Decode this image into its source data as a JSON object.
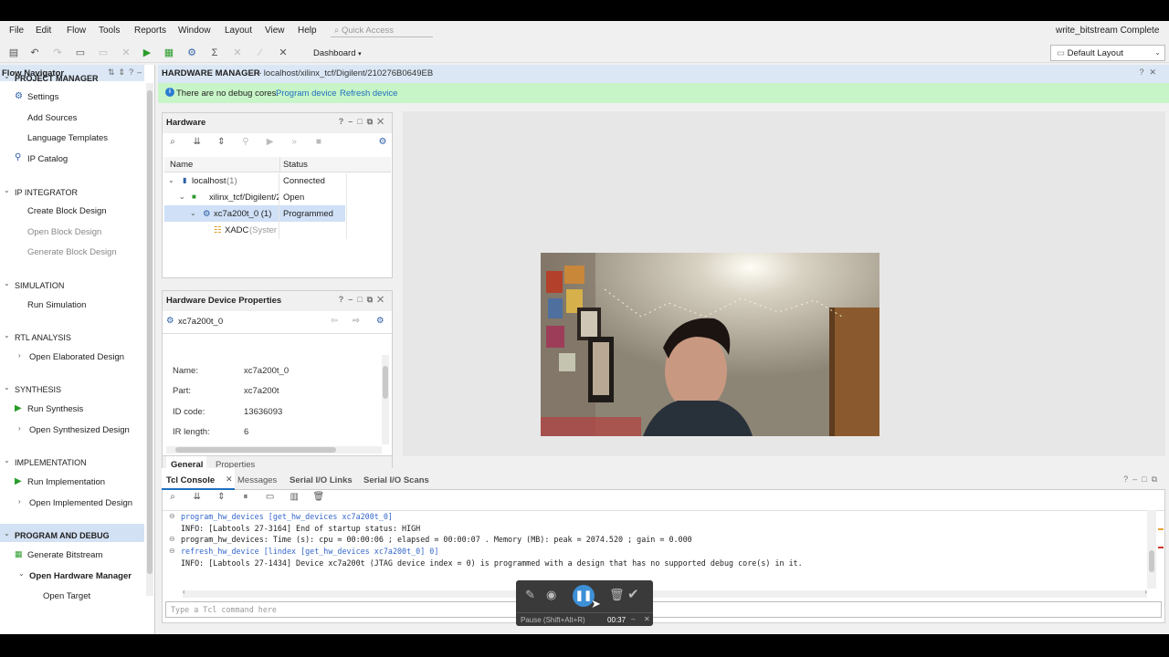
{
  "menu": [
    "File",
    "Edit",
    "Flow",
    "Tools",
    "Reports",
    "Window",
    "Layout",
    "View",
    "Help"
  ],
  "quick_access_placeholder": "Quick Access",
  "status_top": "write_bitstream Complete",
  "dashboard_label": "Dashboard",
  "layout_select": "Default Layout",
  "flow_nav": {
    "title": "Flow Navigator",
    "project_manager": "PROJECT MANAGER",
    "settings": "Settings",
    "add_sources": "Add Sources",
    "language_templates": "Language Templates",
    "ip_catalog": "IP Catalog",
    "ip_integrator": "IP INTEGRATOR",
    "create_block": "Create Block Design",
    "open_block": "Open Block Design",
    "generate_block": "Generate Block Design",
    "simulation": "SIMULATION",
    "run_simulation": "Run Simulation",
    "rtl_analysis": "RTL ANALYSIS",
    "open_elaborated": "Open Elaborated Design",
    "synthesis": "SYNTHESIS",
    "run_synthesis": "Run Synthesis",
    "open_synthesized": "Open Synthesized Design",
    "implementation": "IMPLEMENTATION",
    "run_implementation": "Run Implementation",
    "open_implemented": "Open Implemented Design",
    "program_debug": "PROGRAM AND DEBUG",
    "generate_bitstream": "Generate Bitstream",
    "open_hw_manager": "Open Hardware Manager",
    "open_target": "Open Target"
  },
  "hw_manager": {
    "title": "HARDWARE MANAGER",
    "path": "- localhost/xilinx_tcf/Digilent/210276B0649EB",
    "info": "There are no debug cores.",
    "program_device": "Program device",
    "refresh_device": "Refresh device"
  },
  "hardware": {
    "title": "Hardware",
    "col_name": "Name",
    "col_status": "Status",
    "rows": [
      {
        "name": "localhost",
        "count": "(1)",
        "status": "Connected"
      },
      {
        "name": "xilinx_tcf/Digilent/2",
        "status": "Open"
      },
      {
        "name": "xc7a200t_0 (1)",
        "status": "Programmed"
      },
      {
        "name": "XADC",
        "extra": "(System",
        "status": ""
      }
    ]
  },
  "device_props": {
    "title": "Hardware Device Properties",
    "device": "xc7a200t_0",
    "labels": [
      "Name:",
      "Part:",
      "ID code:",
      "IR length:"
    ],
    "values": [
      "xc7a200t_0",
      "xc7a200t",
      "13636093",
      "6"
    ],
    "tab_general": "General",
    "tab_properties": "Properties"
  },
  "console": {
    "tabs": [
      "Tcl Console",
      "Messages",
      "Serial I/O Links",
      "Serial I/O Scans"
    ],
    "lines": [
      "program_hw_devices [get_hw_devices xc7a200t_0]",
      "INFO: [Labtools 27-3164] End of startup status: HIGH",
      "program_hw_devices: Time (s): cpu = 00:00:06 ; elapsed = 00:00:07 . Memory (MB): peak = 2074.520 ; gain = 0.000",
      "refresh_hw_device [lindex [get_hw_devices xc7a200t_0] 0]",
      "INFO: [Labtools 27-1434] Device xc7a200t (JTAG device index = 0) is programmed with a design that has no supported debug core(s) in it."
    ],
    "input_placeholder": "Type a Tcl command here"
  },
  "recorder": {
    "tooltip": "Pause (Shift+Alt+R)",
    "time": "00:37"
  },
  "colors": {
    "accent": "#1f6fbf",
    "info_bar": "#c8f5c8",
    "selection": "#cfe0f7",
    "recorder_blue": "#3d8fd6"
  }
}
